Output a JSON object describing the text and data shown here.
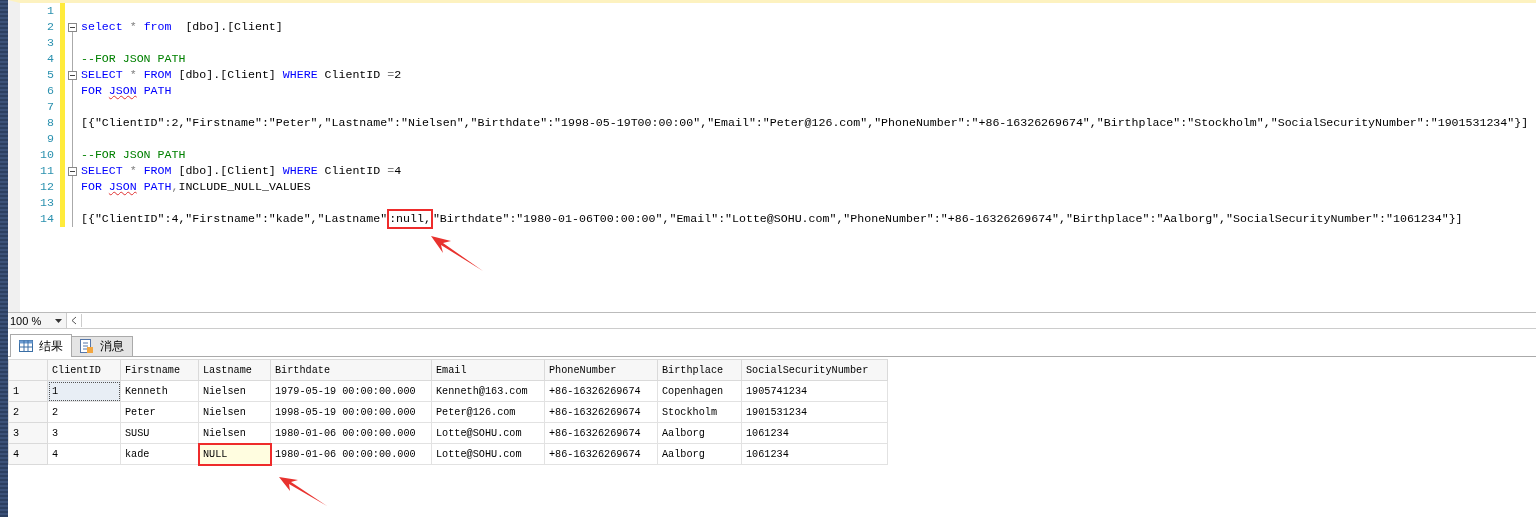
{
  "editor": {
    "lines": [
      {
        "number": "1",
        "fold": false
      },
      {
        "number": "2",
        "fold": true,
        "tokens": [
          {
            "kind": "keyword",
            "text": "select"
          },
          {
            "kind": "op",
            "text": " * "
          },
          {
            "kind": "keyword",
            "text": "from"
          },
          {
            "kind": "plain",
            "text": "  [dbo].[Client]"
          }
        ]
      },
      {
        "number": "3",
        "fold": false
      },
      {
        "number": "4",
        "fold": false,
        "tokens": [
          {
            "kind": "comment",
            "text": "--FOR JSON PATH"
          }
        ]
      },
      {
        "number": "5",
        "fold": true,
        "tokens": [
          {
            "kind": "keyword",
            "text": "SELECT"
          },
          {
            "kind": "op",
            "text": " * "
          },
          {
            "kind": "keyword",
            "text": "FROM"
          },
          {
            "kind": "plain",
            "text": " [dbo].[Client] "
          },
          {
            "kind": "keyword",
            "text": "WHERE"
          },
          {
            "kind": "plain",
            "text": " ClientID "
          },
          {
            "kind": "op",
            "text": "="
          },
          {
            "kind": "plain",
            "text": "2"
          }
        ]
      },
      {
        "number": "6",
        "fold": false,
        "tokens": [
          {
            "kind": "keyword",
            "text": "FOR "
          },
          {
            "kind": "misspelled",
            "text": "JSON"
          },
          {
            "kind": "keyword",
            "text": " PATH"
          }
        ]
      },
      {
        "number": "7",
        "fold": false
      },
      {
        "number": "8",
        "fold": false,
        "tokens": [
          {
            "kind": "plain",
            "text": "[{\"ClientID\":2,\"Firstname\":\"Peter\",\"Lastname\":\"Nielsen\",\"Birthdate\":\"1998-05-19T00:00:00\",\"Email\":\"Peter@126.com\",\"PhoneNumber\":\"+86-16326269674\",\"Birthplace\":\"Stockholm\",\"SocialSecurityNumber\":\"1901531234\"}]"
          }
        ]
      },
      {
        "number": "9",
        "fold": false
      },
      {
        "number": "10",
        "fold": false,
        "tokens": [
          {
            "kind": "comment",
            "text": "--FOR JSON PATH"
          }
        ]
      },
      {
        "number": "11",
        "fold": true,
        "tokens": [
          {
            "kind": "keyword",
            "text": "SELECT"
          },
          {
            "kind": "op",
            "text": " * "
          },
          {
            "kind": "keyword",
            "text": "FROM"
          },
          {
            "kind": "plain",
            "text": " [dbo].[Client] "
          },
          {
            "kind": "keyword",
            "text": "WHERE"
          },
          {
            "kind": "plain",
            "text": " ClientID "
          },
          {
            "kind": "op",
            "text": "="
          },
          {
            "kind": "plain",
            "text": "4"
          }
        ]
      },
      {
        "number": "12",
        "fold": false,
        "tokens": [
          {
            "kind": "keyword",
            "text": "FOR "
          },
          {
            "kind": "misspelled",
            "text": "JSON"
          },
          {
            "kind": "keyword",
            "text": " PATH"
          },
          {
            "kind": "op",
            "text": ","
          },
          {
            "kind": "plain",
            "text": "INCLUDE_NULL_VALUES"
          }
        ]
      },
      {
        "number": "13",
        "fold": false
      },
      {
        "number": "14",
        "fold": false,
        "tokens": [
          {
            "kind": "plain",
            "text": "[{\"ClientID\":4,\"Firstname\":\"kade\",\"Lastname\""
          },
          {
            "kind": "highlight",
            "text": ":null,"
          },
          {
            "kind": "plain",
            "text": "\"Birthdate\":\"1980-01-06T00:00:00\",\"Email\":\"Lotte@SOHU.com\",\"PhoneNumber\":\"+86-16326269674\",\"Birthplace\":\"Aalborg\",\"SocialSecurityNumber\":\"1061234\"}]"
          }
        ]
      }
    ]
  },
  "zoom": {
    "value": "100 %"
  },
  "tabs": [
    {
      "label": "结果",
      "selected": true
    },
    {
      "label": "消息",
      "selected": false
    }
  ],
  "grid": {
    "columns": [
      "ClientID",
      "Firstname",
      "Lastname",
      "Birthdate",
      "Email",
      "PhoneNumber",
      "Birthplace",
      "SocialSecurityNumber"
    ],
    "rows": [
      {
        "number": "1",
        "cells": [
          {
            "text": "1",
            "focused": true
          },
          {
            "text": "Kenneth"
          },
          {
            "text": "Nielsen"
          },
          {
            "text": "1979-05-19 00:00:00.000"
          },
          {
            "text": "Kenneth@163.com"
          },
          {
            "text": "+86-16326269674"
          },
          {
            "text": "Copenhagen"
          },
          {
            "text": "1905741234"
          }
        ]
      },
      {
        "number": "2",
        "cells": [
          {
            "text": "2"
          },
          {
            "text": "Peter"
          },
          {
            "text": "Nielsen"
          },
          {
            "text": "1998-05-19 00:00:00.000"
          },
          {
            "text": "Peter@126.com"
          },
          {
            "text": "+86-16326269674"
          },
          {
            "text": "Stockholm"
          },
          {
            "text": "1901531234"
          }
        ]
      },
      {
        "number": "3",
        "cells": [
          {
            "text": "3"
          },
          {
            "text": "SUSU"
          },
          {
            "text": "Nielsen"
          },
          {
            "text": "1980-01-06 00:00:00.000"
          },
          {
            "text": "Lotte@SOHU.com"
          },
          {
            "text": "+86-16326269674"
          },
          {
            "text": "Aalborg"
          },
          {
            "text": "1061234"
          }
        ]
      },
      {
        "number": "4",
        "cells": [
          {
            "text": "4"
          },
          {
            "text": "kade"
          },
          {
            "text": "NULL",
            "is_null": true,
            "highlighted": true
          },
          {
            "text": "1980-01-06 00:00:00.000"
          },
          {
            "text": "Lotte@SOHU.com"
          },
          {
            "text": "+86-16326269674"
          },
          {
            "text": "Aalborg"
          },
          {
            "text": "1061234"
          }
        ]
      }
    ]
  }
}
